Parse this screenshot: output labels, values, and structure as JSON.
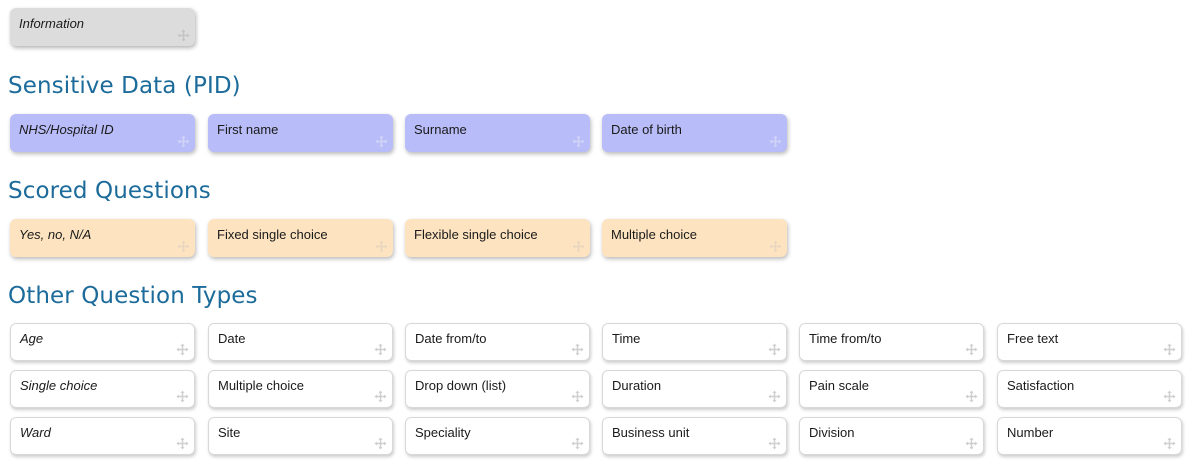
{
  "information": {
    "label": "Information"
  },
  "sections": {
    "pid": {
      "title": "Sensitive Data (PID)",
      "items": [
        "NHS/Hospital ID",
        "First name",
        "Surname",
        "Date of birth"
      ]
    },
    "scored": {
      "title": "Scored Questions",
      "items": [
        "Yes, no, N/A",
        "Fixed single choice",
        "Flexible single choice",
        "Multiple choice"
      ]
    },
    "other": {
      "title": "Other Question Types",
      "rows": [
        [
          "Age",
          "Date",
          "Date from/to",
          "Time",
          "Time from/to",
          "Free text"
        ],
        [
          "Single choice",
          "Multiple choice",
          "Drop down (list)",
          "Duration",
          "Pain scale",
          "Satisfaction"
        ],
        [
          "Ward",
          "Site",
          "Speciality",
          "Business unit",
          "Division",
          "Number"
        ]
      ]
    }
  },
  "icons": {
    "drag": "move-handle-icon"
  },
  "colors": {
    "heading": "#1c6b9a",
    "information_bg": "#dcdcdc",
    "pid_bg": "#b8bcf8",
    "scored_bg": "#fde3bf",
    "other_bg": "#ffffff"
  }
}
